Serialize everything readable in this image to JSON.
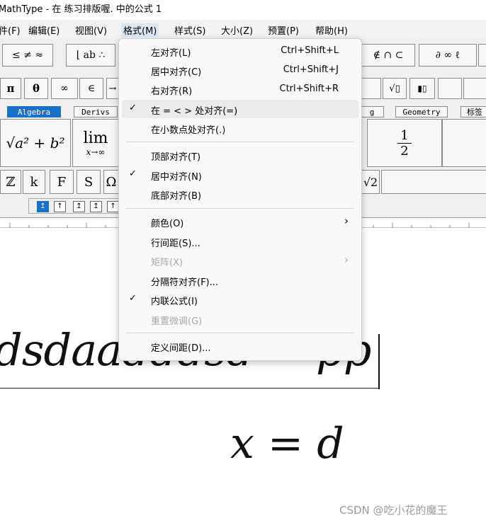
{
  "window": {
    "title": "MathType - 在 练习排版喔. 中的公式 1"
  },
  "menubar": {
    "items": [
      {
        "label": "件(F)"
      },
      {
        "label": "编辑(E)"
      },
      {
        "label": "视图(V)"
      },
      {
        "label": "格式(M)"
      },
      {
        "label": "样式(S)"
      },
      {
        "label": "大小(Z)"
      },
      {
        "label": "预置(P)"
      },
      {
        "label": "帮助(H)"
      }
    ]
  },
  "palettes": {
    "row1": [
      "≤ ≠ ≈",
      "⌊ ab ∴",
      "∉ ∩ ⊂",
      "∂ ∞ ℓ"
    ],
    "row2": [
      "π",
      "θ",
      "∞",
      "∈",
      "→",
      "√▯",
      "▮▯"
    ],
    "tabs": [
      "Algebra",
      "Derivs",
      "g",
      "Geometry",
      "标签"
    ],
    "templates": {
      "sqrt": "√a² + b²",
      "lim_top": "lim",
      "lim_sub": "x→∞",
      "frac_num": "1",
      "frac_den": "2"
    },
    "row4": [
      "ℤ",
      "k",
      "F",
      "S",
      "Ω"
    ],
    "row4_right": "√2"
  },
  "format_menu": {
    "items": [
      {
        "label": "左对齐(L)",
        "shortcut": "Ctrl+Shift+L"
      },
      {
        "label": "居中对齐(C)",
        "shortcut": "Ctrl+Shift+J"
      },
      {
        "label": "右对齐(R)",
        "shortcut": "Ctrl+Shift+R"
      },
      {
        "label": "在 = < > 处对齐(=)",
        "checked": true
      },
      {
        "label": "在小数点处对齐(.)"
      },
      {
        "label": "顶部对齐(T)"
      },
      {
        "label": "居中对齐(N)",
        "checked": true
      },
      {
        "label": "底部对齐(B)"
      },
      {
        "label": "颜色(O)",
        "submenu": true
      },
      {
        "label": "行间距(S)..."
      },
      {
        "label": "矩阵(X)",
        "submenu": true,
        "disabled": true
      },
      {
        "label": "分隔符对齐(F)..."
      },
      {
        "label": "内联公式(I)",
        "checked": true
      },
      {
        "label": "重置微调(G)",
        "disabled": true
      },
      {
        "label": "定义间距(D)..."
      }
    ],
    "check_glyph": "✓",
    "submenu_glyph": "›"
  },
  "document": {
    "line1": "dsdaadddsd = pp",
    "line2": "x = d"
  },
  "watermark": "CSDN @吃小花的魔王",
  "colors": {
    "accent": "#1a6fc9",
    "menu_bg": "#f9f9f9",
    "highlight": "#ebebeb"
  }
}
